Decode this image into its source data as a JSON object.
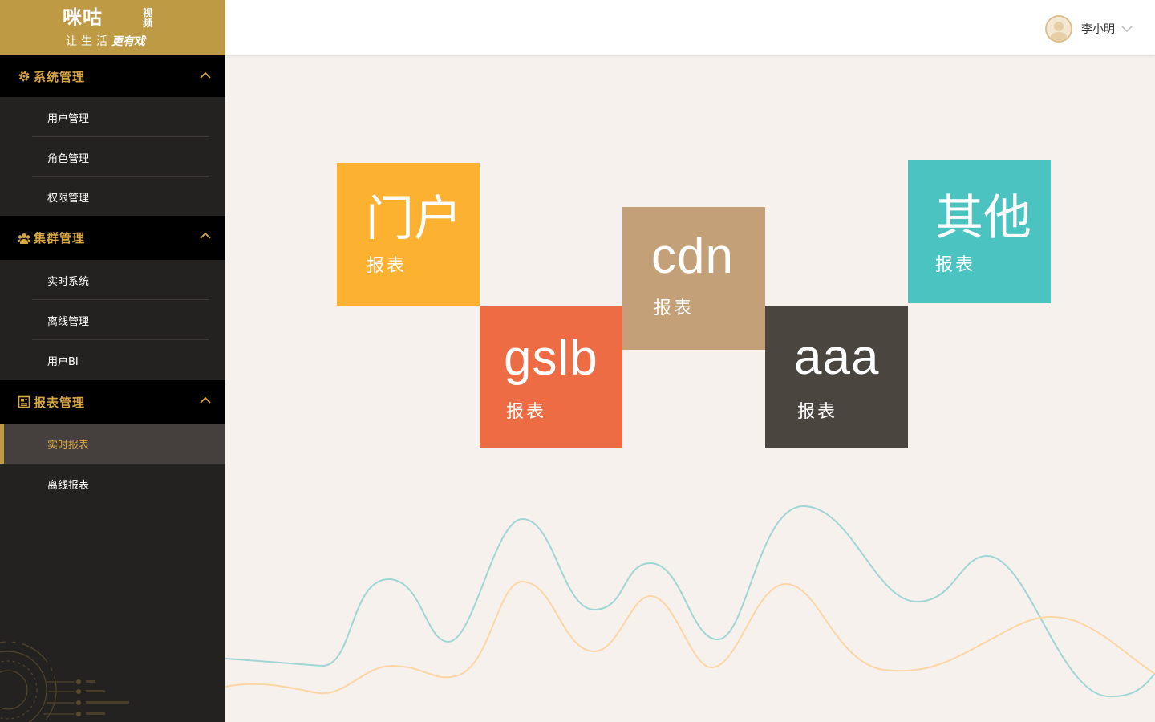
{
  "app": {
    "logo_text": "咪咕",
    "logo_sub": "视频",
    "slogan_plain": "让生活",
    "slogan_em": "更有戏"
  },
  "header": {
    "username": "李小明"
  },
  "sidebar": {
    "groups": [
      {
        "label": "系统管理",
        "icon": "gear-icon",
        "items": [
          {
            "label": "用户管理"
          },
          {
            "label": "角色管理"
          },
          {
            "label": "权限管理"
          }
        ]
      },
      {
        "label": "集群管理",
        "icon": "group-icon",
        "items": [
          {
            "label": "实时系统"
          },
          {
            "label": "离线管理"
          },
          {
            "label": "用户BI"
          }
        ]
      },
      {
        "label": "报表管理",
        "icon": "report-icon",
        "items": [
          {
            "label": "实时报表",
            "active": true
          },
          {
            "label": "离线报表"
          }
        ]
      }
    ]
  },
  "tiles": [
    {
      "title": "门户",
      "subtitle": "报表",
      "color": "#fdb130"
    },
    {
      "title": "gslb",
      "subtitle": "报表",
      "color": "#ee6c44"
    },
    {
      "title": "cdn",
      "subtitle": "报表",
      "color": "#c3a077"
    },
    {
      "title": "aaa",
      "subtitle": "报表",
      "color": "#4b4540"
    },
    {
      "title": "其他",
      "subtitle": "报表",
      "color": "#4bc4c1"
    }
  ],
  "colors": {
    "accent": "#be9a45",
    "sidebar_bg": "#242220",
    "wave_teal": "#9fd6d5",
    "wave_orange": "#fbd6a4"
  }
}
